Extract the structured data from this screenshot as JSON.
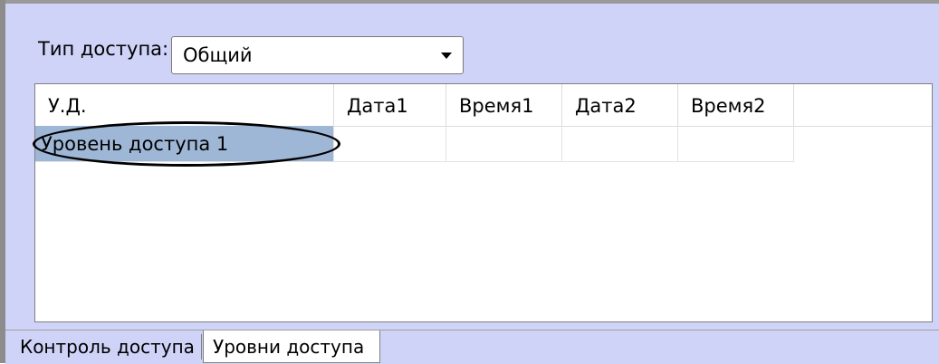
{
  "access_type": {
    "label": "Тип доступа:",
    "value": "Общий"
  },
  "grid": {
    "columns": [
      "У.Д.",
      "Дата1",
      "Время1",
      "Дата2",
      "Время2"
    ],
    "rows": [
      {
        "ud": "Уровень доступа 1",
        "date1": "",
        "time1": "",
        "date2": "",
        "time2": ""
      }
    ]
  },
  "tabs": [
    "Контроль доступа",
    "Уровни доступа"
  ],
  "active_tab": "Уровни доступа",
  "colors": {
    "panel_bg": "#cfd3f7",
    "selected_row": "#9fb7d6"
  }
}
